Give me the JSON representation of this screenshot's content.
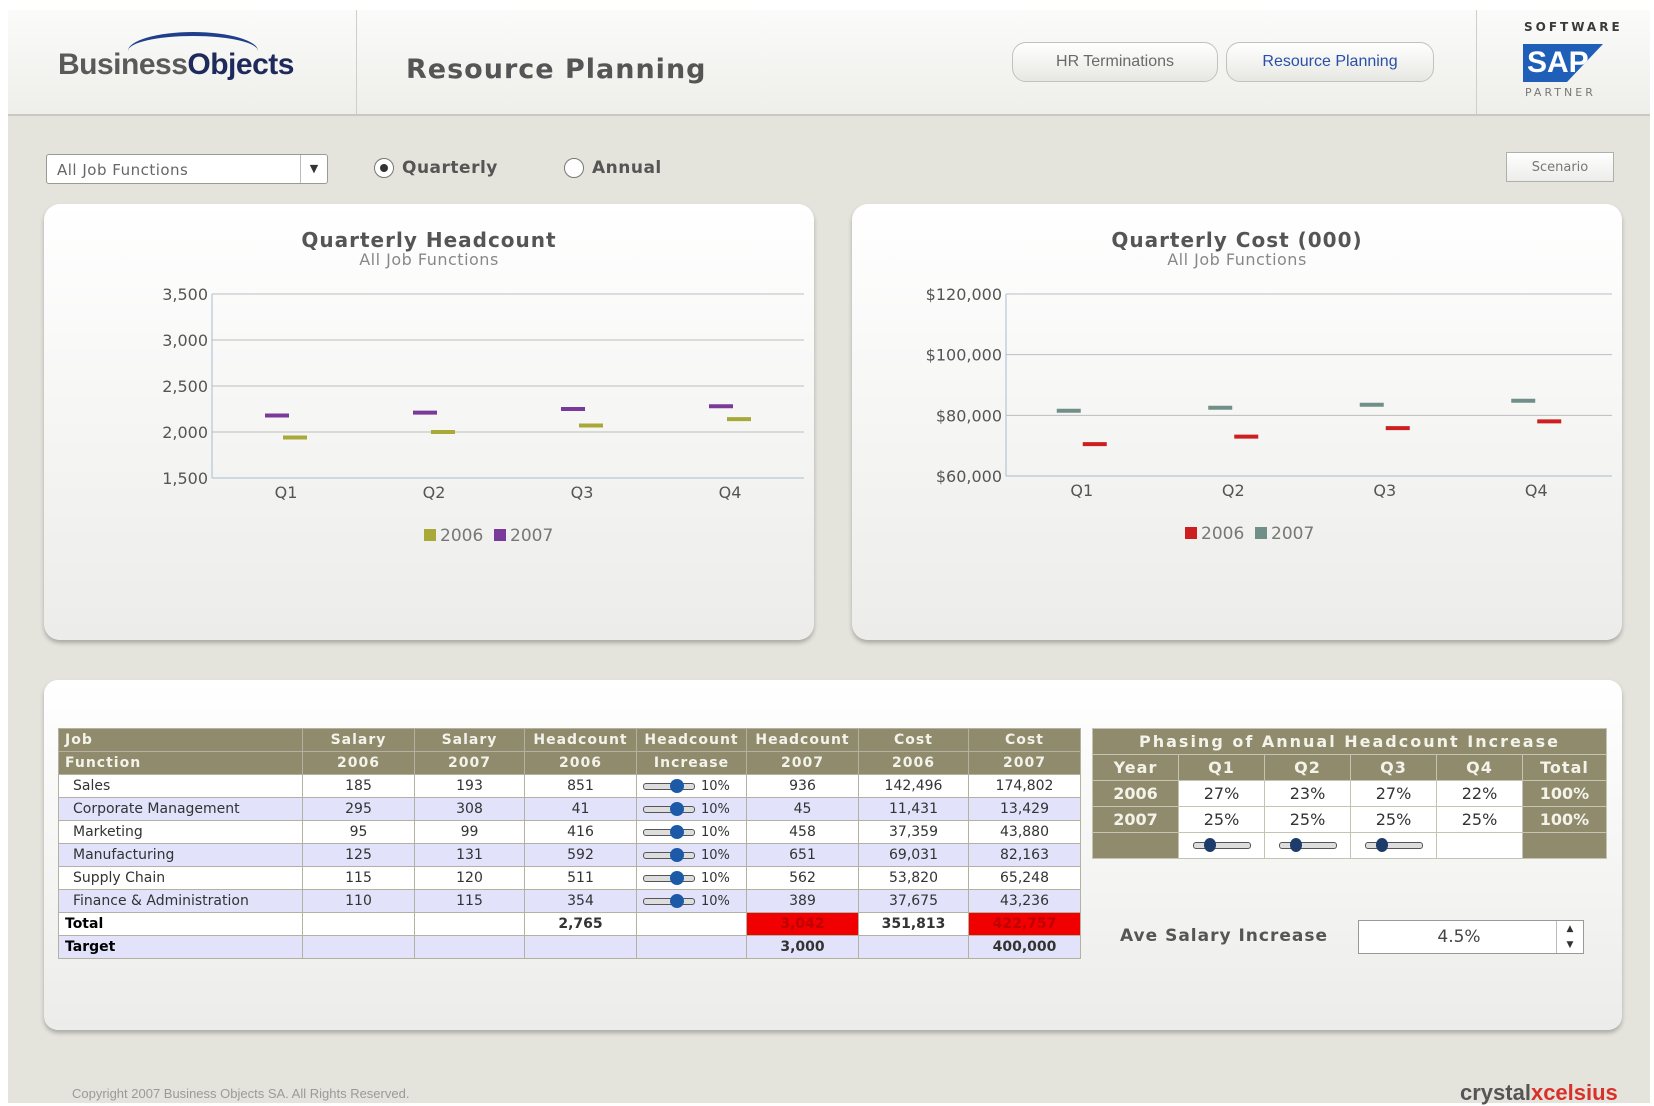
{
  "header": {
    "logo_prefix": "Business",
    "logo_suffix": "Objects",
    "title": "Resource Planning",
    "nav": [
      "HR Terminations",
      "Resource Planning"
    ],
    "sap_top": "SOFTWARE",
    "sap_logo": "SAP",
    "sap_bottom": "PARTNER"
  },
  "controls": {
    "job_select": "All Job Functions",
    "radio_quarterly": "Quarterly",
    "radio_annual": "Annual",
    "selected_period": "Quarterly",
    "scenario_button": "Scenario"
  },
  "chart_data": [
    {
      "type": "line",
      "title": "Quarterly Headcount",
      "subtitle": "All Job Functions",
      "categories": [
        "Q1",
        "Q2",
        "Q3",
        "Q4"
      ],
      "y_ticks": [
        "3,500",
        "3,000",
        "2,500",
        "2,000",
        "1,500"
      ],
      "ylim": [
        1500,
        3500
      ],
      "series": [
        {
          "name": "2006",
          "color": "#a9a93a",
          "values": [
            1940,
            2000,
            2070,
            2140
          ]
        },
        {
          "name": "2007",
          "color": "#7a3a9a",
          "values": [
            2180,
            2210,
            2250,
            2280
          ]
        }
      ],
      "legend": "bottom",
      "grid": true
    },
    {
      "type": "line",
      "title": "Quarterly Cost (000)",
      "subtitle": "All Job Functions",
      "categories": [
        "Q1",
        "Q2",
        "Q3",
        "Q4"
      ],
      "y_ticks": [
        "$120,000",
        "$100,000",
        "$80,000",
        "$60,000"
      ],
      "ylim": [
        60000,
        120000
      ],
      "series": [
        {
          "name": "2006",
          "color": "#cc1f1f",
          "values": [
            70500,
            73000,
            75800,
            78000
          ]
        },
        {
          "name": "2007",
          "color": "#6f8f88",
          "values": [
            81500,
            82500,
            83500,
            84800
          ]
        }
      ],
      "legend": "bottom",
      "grid": true
    }
  ],
  "table": {
    "header_row1": [
      "Job",
      "Salary",
      "Salary",
      "Headcount",
      "Headcount",
      "Headcount",
      "Cost",
      "Cost"
    ],
    "header_row2": [
      "Function",
      "2006",
      "2007",
      "2006",
      "Increase",
      "2007",
      "2006",
      "2007"
    ],
    "rows": [
      {
        "name": "Sales",
        "sal06": "185",
        "sal07": "193",
        "hc06": "851",
        "inc": "10%",
        "inc_fraction": 0.65,
        "hc07": "936",
        "cost06": "142,496",
        "cost07": "174,802"
      },
      {
        "name": "Corporate Management",
        "sal06": "295",
        "sal07": "308",
        "hc06": "41",
        "inc": "10%",
        "inc_fraction": 0.65,
        "hc07": "45",
        "cost06": "11,431",
        "cost07": "13,429"
      },
      {
        "name": "Marketing",
        "sal06": "95",
        "sal07": "99",
        "hc06": "416",
        "inc": "10%",
        "inc_fraction": 0.65,
        "hc07": "458",
        "cost06": "37,359",
        "cost07": "43,880"
      },
      {
        "name": "Manufacturing",
        "sal06": "125",
        "sal07": "131",
        "hc06": "592",
        "inc": "10%",
        "inc_fraction": 0.65,
        "hc07": "651",
        "cost06": "69,031",
        "cost07": "82,163"
      },
      {
        "name": "Supply Chain",
        "sal06": "115",
        "sal07": "120",
        "hc06": "511",
        "inc": "10%",
        "inc_fraction": 0.65,
        "hc07": "562",
        "cost06": "53,820",
        "cost07": "65,248"
      },
      {
        "name": "Finance & Administration",
        "sal06": "110",
        "sal07": "115",
        "hc06": "354",
        "inc": "10%",
        "inc_fraction": 0.65,
        "hc07": "389",
        "cost06": "37,675",
        "cost07": "43,236"
      }
    ],
    "total": {
      "label": "Total",
      "hc06": "2,765",
      "hc07": "3,042",
      "cost06": "351,813",
      "cost07": "422,757"
    },
    "target": {
      "label": "Target",
      "hc07": "3,000",
      "cost07": "400,000"
    }
  },
  "phasing": {
    "title": "Phasing of Annual Headcount Increase",
    "headers": [
      "Year",
      "Q1",
      "Q2",
      "Q3",
      "Q4",
      "Total"
    ],
    "rows": [
      {
        "year": "2006",
        "q1": "27%",
        "q2": "23%",
        "q3": "27%",
        "q4": "22%",
        "total": "100%"
      },
      {
        "year": "2007",
        "q1": "25%",
        "q2": "25%",
        "q3": "25%",
        "q4": "25%",
        "total": "100%"
      }
    ],
    "slider_fractions": [
      0.3,
      0.3,
      0.3
    ]
  },
  "salary": {
    "label": "Ave Salary Increase",
    "value": "4.5%"
  },
  "footer": {
    "copyright": "Copyright 2007 Business Objects SA. All Rights Reserved.",
    "brand_prefix": "crystal",
    "brand_suffix": "xcelsius"
  }
}
